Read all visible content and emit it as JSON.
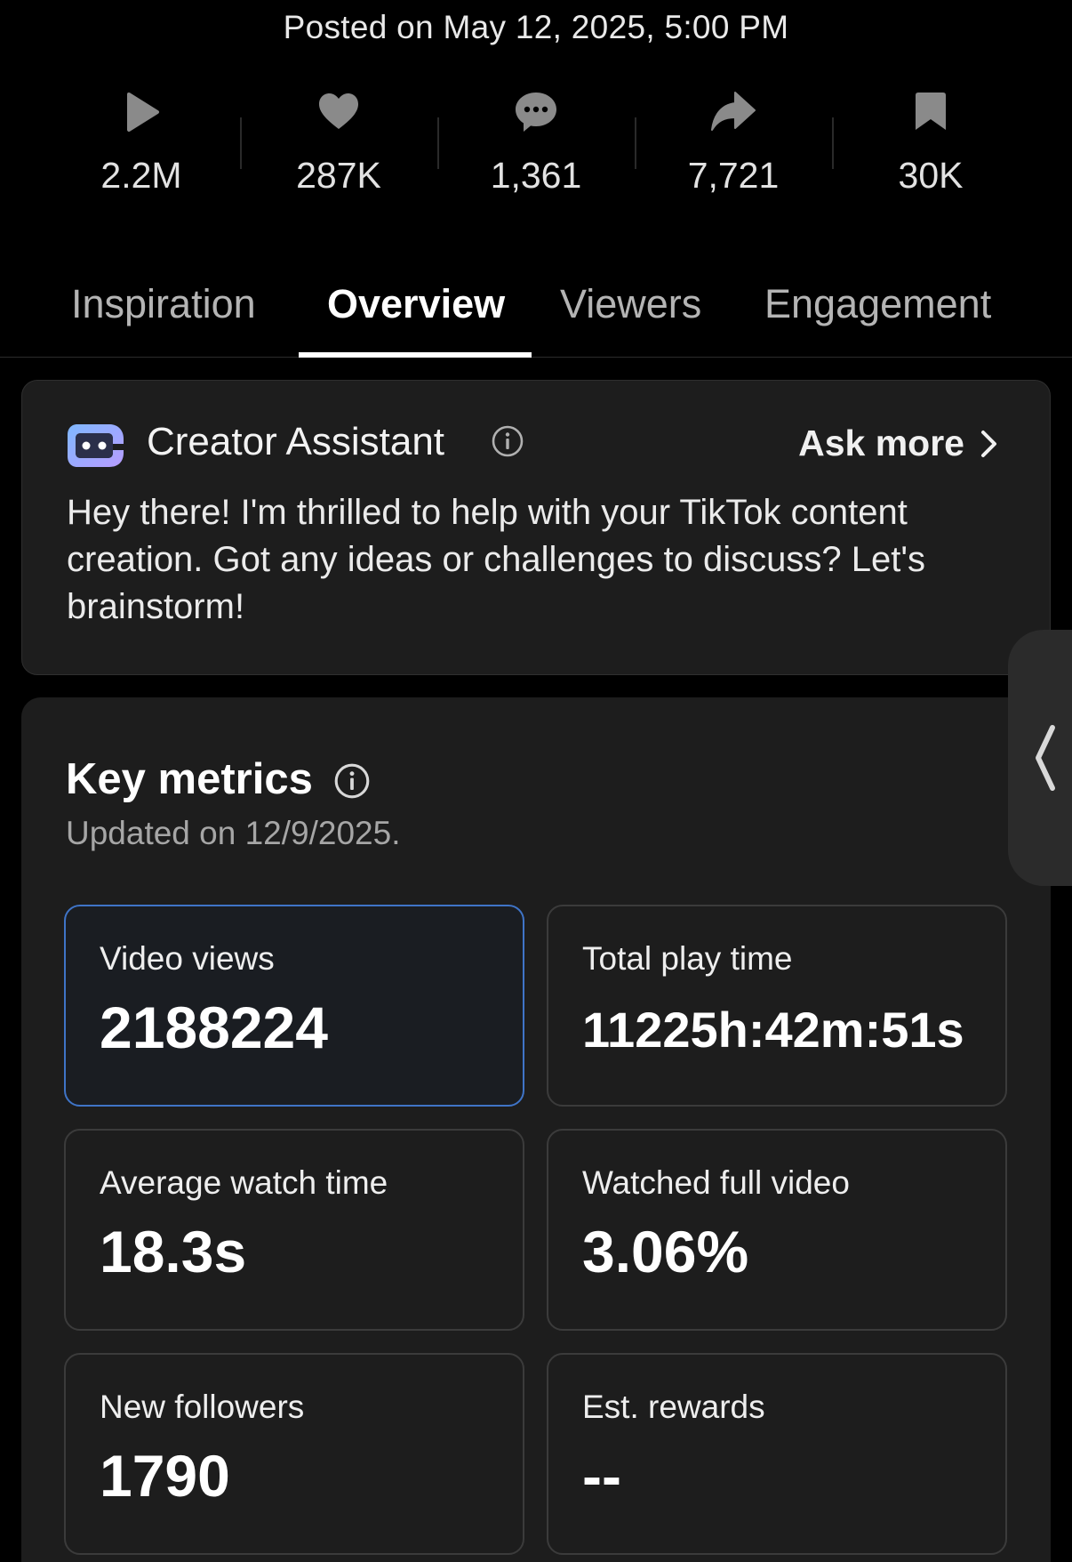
{
  "header": {
    "posted": "Posted on May 12, 2025, 5:00 PM"
  },
  "stats": [
    {
      "icon": "play-icon",
      "value": "2.2M"
    },
    {
      "icon": "heart-icon",
      "value": "287K"
    },
    {
      "icon": "comment-icon",
      "value": "1,361"
    },
    {
      "icon": "share-icon",
      "value": "7,721"
    },
    {
      "icon": "bookmark-icon",
      "value": "30K"
    }
  ],
  "tabs": [
    {
      "label": "Inspiration",
      "active": false
    },
    {
      "label": "Overview",
      "active": true
    },
    {
      "label": "Viewers",
      "active": false
    },
    {
      "label": "Engagement",
      "active": false
    }
  ],
  "assistant": {
    "title": "Creator Assistant",
    "ask_more": "Ask more",
    "message": "Hey there! I'm thrilled to help with your TikTok content creation. Got any ideas or challenges to discuss? Let's brainstorm!"
  },
  "metrics": {
    "title": "Key metrics",
    "updated": "Updated on 12/9/2025.",
    "items": [
      {
        "label": "Video views",
        "value": "2188224",
        "selected": true
      },
      {
        "label": "Total play time",
        "value": "11225h:42m:51s",
        "selected": false
      },
      {
        "label": "Average watch time",
        "value": "18.3s",
        "selected": false
      },
      {
        "label": "Watched full video",
        "value": "3.06%",
        "selected": false
      },
      {
        "label": "New followers",
        "value": "1790",
        "selected": false
      },
      {
        "label": "Est. rewards",
        "value": "--",
        "selected": false
      }
    ]
  },
  "colors": {
    "background": "#000000",
    "card": "#1d1d1d",
    "selected_border": "#3f74c7",
    "icon_gray": "#8a8a8a"
  }
}
